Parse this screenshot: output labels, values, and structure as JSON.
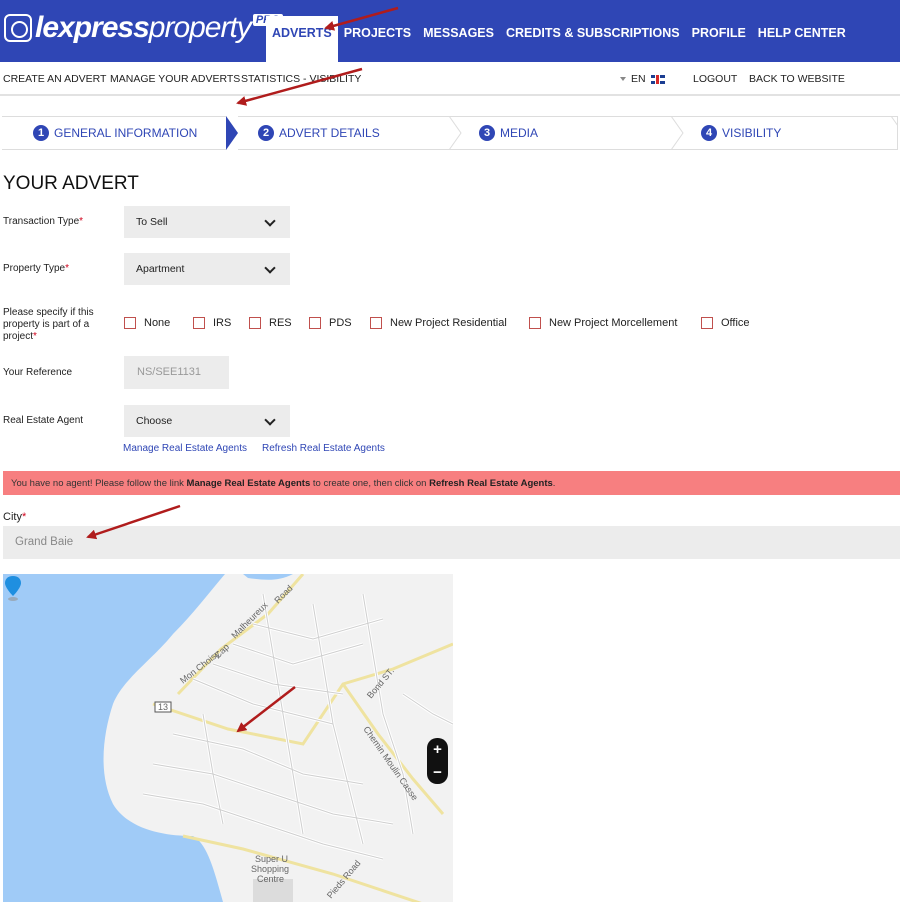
{
  "brand": {
    "name_bold": "lexpress",
    "name_light": "property",
    "badge": "PRO"
  },
  "main_nav": [
    "ADVERTS",
    "PROJECTS",
    "MESSAGES",
    "CREDITS & SUBSCRIPTIONS",
    "PROFILE",
    "HELP CENTER"
  ],
  "sub_nav": {
    "left": [
      "CREATE AN ADVERT",
      "MANAGE YOUR ADVERTS",
      "STATISTICS - VISIBILITY"
    ],
    "language": "EN",
    "right": [
      "LOGOUT",
      "BACK TO WEBSITE"
    ]
  },
  "steps": [
    {
      "num": "1",
      "label": "GENERAL INFORMATION"
    },
    {
      "num": "2",
      "label": "ADVERT DETAILS"
    },
    {
      "num": "3",
      "label": "MEDIA"
    },
    {
      "num": "4",
      "label": "VISIBILITY"
    }
  ],
  "form": {
    "heading": "YOUR ADVERT",
    "transaction_label": "Transaction Type",
    "transaction_value": "To Sell",
    "property_label": "Property Type",
    "property_value": "Apartment",
    "project_label_1": "Please specify if this",
    "project_label_2": "property is part of a",
    "project_label_3": "project",
    "project_options": [
      "None",
      "IRS",
      "RES",
      "PDS",
      "New Project Residential",
      "New Project Morcellement",
      "Office"
    ],
    "reference_label": "Your Reference",
    "reference_value": "NS/SEE1131",
    "agent_label": "Real Estate Agent",
    "agent_value": "Choose",
    "manage_agents_link": "Manage Real Estate Agents",
    "refresh_agents_link": "Refresh Real Estate Agents",
    "required_mark": "*"
  },
  "alert": {
    "part1": "You have no agent! Please follow the link ",
    "link1": "Manage Real Estate Agents",
    "part2": " to create one, then click on ",
    "link2": "Refresh Real Estate Agents",
    "part3": "."
  },
  "city": {
    "label": "City",
    "value": "Grand Baie"
  },
  "map": {
    "labels": [
      "Mon Choisy",
      "Cap",
      "Malheureux",
      "Road",
      "Bond ST.",
      "Chemin Moulin Casse",
      "Pieds Road",
      "13",
      "Super U",
      "Shopping",
      "Centre"
    ],
    "zoom_in": "+",
    "zoom_out": "−"
  },
  "colors": {
    "brand_blue": "#2f46b5",
    "alert_bg": "#f77f80",
    "water": "#a0cbf7",
    "pin": "#1f8fe0",
    "annotation": "#b01c1c"
  }
}
